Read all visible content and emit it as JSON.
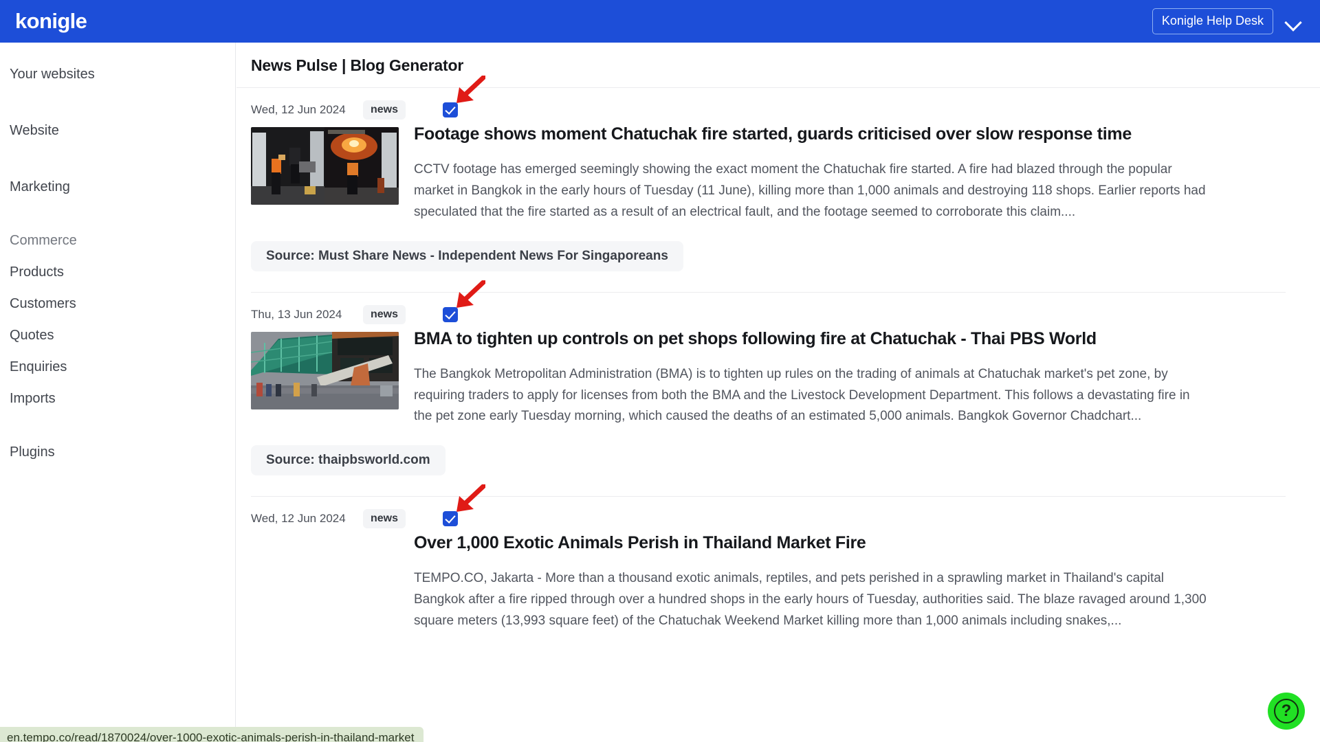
{
  "topbar": {
    "brand": "konigle",
    "help_desk_label": "Konigle Help Desk",
    "chevron_icon": "chevron-down-icon",
    "background": "#1d4ed8"
  },
  "sidebar": {
    "items": [
      {
        "label": "Your websites",
        "type": "link"
      },
      {
        "label": "Website",
        "type": "link"
      },
      {
        "label": "Marketing",
        "type": "link"
      },
      {
        "label": "Commerce",
        "type": "section"
      },
      {
        "label": "Products",
        "type": "link"
      },
      {
        "label": "Customers",
        "type": "link"
      },
      {
        "label": "Quotes",
        "type": "link"
      },
      {
        "label": "Enquiries",
        "type": "link"
      },
      {
        "label": "Imports",
        "type": "link"
      },
      {
        "label": "Plugins",
        "type": "link"
      }
    ]
  },
  "main": {
    "page_title": "News Pulse | Blog Generator",
    "articles": [
      {
        "date": "Wed, 12 Jun 2024",
        "tag": "news",
        "checked": true,
        "headline": "Footage shows moment Chatuchak fire started, guards criticised over slow response time",
        "summary": "CCTV footage has emerged seemingly showing the exact moment the Chatuchak fire started. A fire had blazed through the popular market in Bangkok in the early hours of Tuesday (11 June), killing more than 1,000 animals and destroying 118 shops. Earlier reports had speculated that the fire started as a result of an electrical fault, and the footage seemed to corroborate this claim....",
        "source": "Source: Must Share News - Independent News For Singaporeans",
        "thumbnail": "cctv-footage-split-screen-fire"
      },
      {
        "date": "Thu, 13 Jun 2024",
        "tag": "news",
        "checked": true,
        "headline": "BMA to tighten up controls on pet shops following fire at Chatuchak - Thai PBS World",
        "summary": "The Bangkok Metropolitan Administration (BMA) is to tighten up rules on the trading of animals at Chatuchak market's pet zone, by requiring traders to apply for licenses from both the BMA and the Livestock Development Department. This follows a devastating fire in the pet zone early Tuesday morning, which caused the deaths of an estimated 5,000 animals. Bangkok Governor Chadchart...",
        "source": "Source: thaipbsworld.com",
        "thumbnail": "burned-market-collapsed-awning"
      },
      {
        "date": "Wed, 12 Jun 2024",
        "tag": "news",
        "checked": true,
        "headline": "Over 1,000 Exotic Animals Perish in Thailand Market Fire",
        "summary": "TEMPO.CO, Jakarta - More than a thousand exotic animals, reptiles, and pets perished in a sprawling market in Thailand's capital Bangkok after a fire ripped through over a hundred shops in the early hours of Tuesday, authorities said. The blaze ravaged around 1,300 square meters (13,993 square feet) of the Chatuchak Weekend Market killing more than 1,000 animals including snakes,...",
        "source": "",
        "thumbnail": null
      }
    ],
    "annotation_arrow_color": "#e01b16"
  },
  "statusbar": {
    "url": "en.tempo.co/read/1870024/over-1000-exotic-animals-perish-in-thailand-market"
  },
  "help_widget": {
    "icon": "question-mark-icon",
    "color": "#21e024"
  }
}
